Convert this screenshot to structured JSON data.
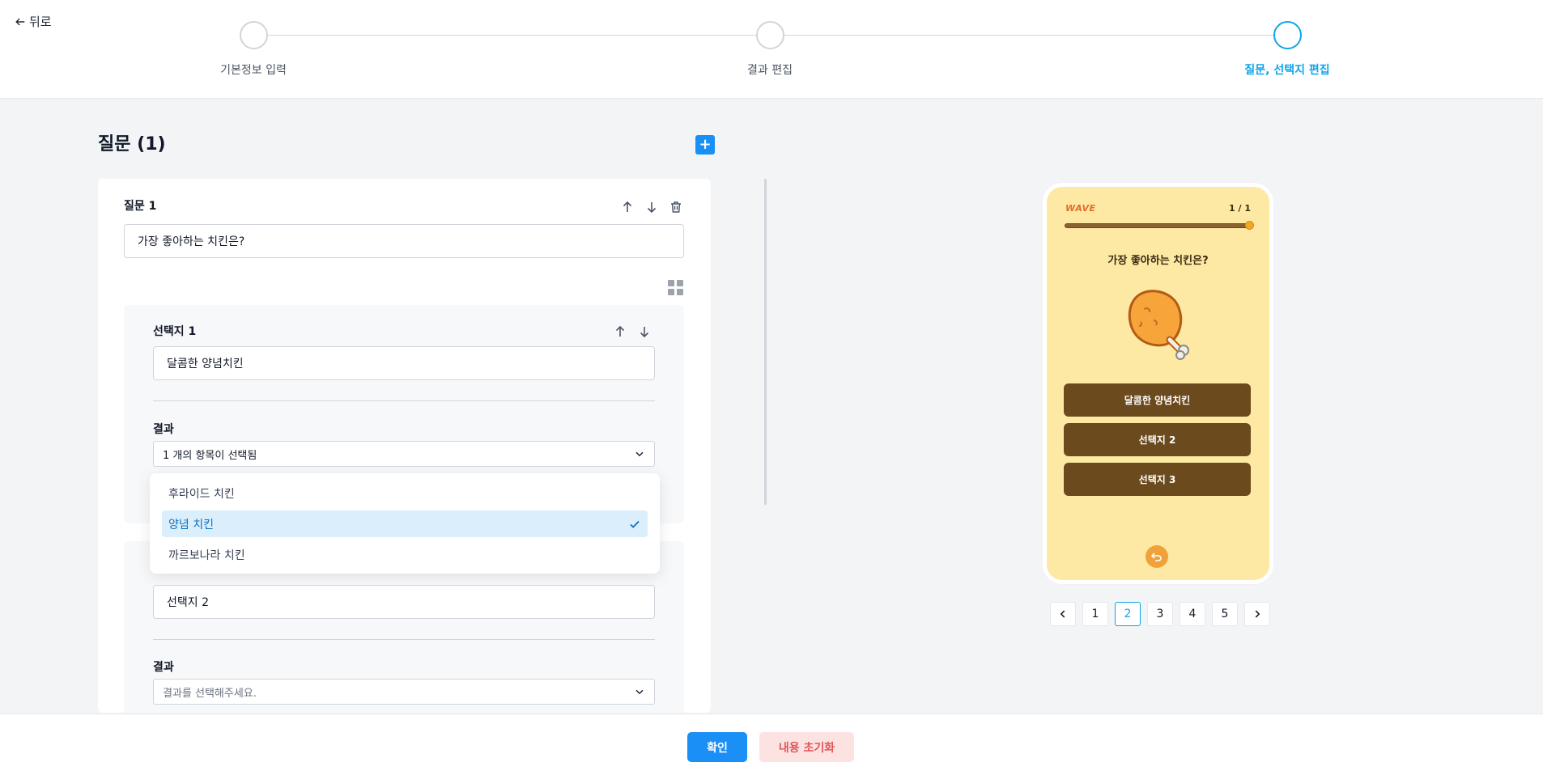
{
  "nav": {
    "back_label": "뒤로"
  },
  "stepper": {
    "steps": [
      {
        "label": "기본정보 입력"
      },
      {
        "label": "결과 편집"
      },
      {
        "label": "질문, 선택지 편집"
      }
    ],
    "active_index": 2
  },
  "questions": {
    "title": "질문 (1)",
    "add_symbol": "+"
  },
  "question1": {
    "label": "질문 1",
    "value": "가장 좋아하는 치킨은?",
    "choice1": {
      "label": "선택지 1",
      "value": "달콤한 양념치킨",
      "result_label": "결과",
      "result_value": "1 개의 항목이 선택됨"
    },
    "choice2": {
      "value": "선택지 2",
      "result_label": "결과",
      "result_placeholder": "결과를 선택해주세요."
    }
  },
  "dropdown": {
    "options": [
      {
        "label": "후라이드 치킨",
        "selected": false
      },
      {
        "label": "양념 치킨",
        "selected": true
      },
      {
        "label": "까르보나라 치킨",
        "selected": false
      }
    ]
  },
  "preview": {
    "logo_text": "WAVE",
    "counter": "1 / 1",
    "progress": 1.0,
    "question": "가장 좋아하는 치킨은?",
    "image": "fried-chicken-drumstick",
    "choices": [
      "달콤한 양념치킨",
      "선택지 2",
      "선택지 3"
    ],
    "background_color": "#fde9a3",
    "button_color": "#6b4a1d"
  },
  "pagination": {
    "pages": [
      "1",
      "2",
      "3",
      "4",
      "5"
    ],
    "current": "2"
  },
  "footer": {
    "confirm_label": "확인",
    "reset_label": "내용 초기화"
  },
  "colors": {
    "accent": "#1a8ff5",
    "active_step": "#0ea5e9",
    "reset_bg": "#fde2e2",
    "reset_text": "#e25555"
  }
}
